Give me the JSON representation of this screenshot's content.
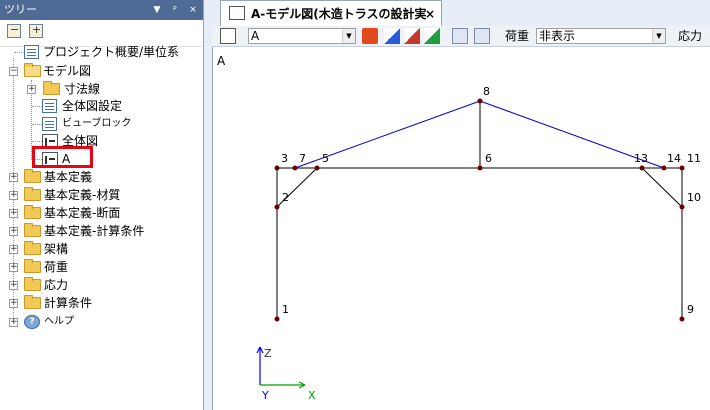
{
  "tree": {
    "title": "ツリー",
    "header_buttons": [
      "▼",
      "ᵖ",
      "×"
    ],
    "items": [
      {
        "label": "プロジェクト概要/単位系",
        "icon": "doc-icon"
      },
      {
        "label": "モデル図",
        "icon": "folder-open-icon"
      },
      {
        "label": "寸法線",
        "icon": "folder-icon"
      },
      {
        "label": "全体図設定",
        "icon": "doc-icon"
      },
      {
        "label": "ビューブロック",
        "icon": "doc-icon"
      },
      {
        "label": "全体図",
        "icon": "model-icon"
      },
      {
        "label": "A",
        "icon": "model-icon"
      },
      {
        "label": "基本定義",
        "icon": "folder-icon"
      },
      {
        "label": "基本定義-材質",
        "icon": "folder-icon"
      },
      {
        "label": "基本定義-断面",
        "icon": "folder-icon"
      },
      {
        "label": "基本定義-計算条件",
        "icon": "folder-icon"
      },
      {
        "label": "架構",
        "icon": "folder-icon"
      },
      {
        "label": "荷重",
        "icon": "folder-icon"
      },
      {
        "label": "応力",
        "icon": "folder-icon"
      },
      {
        "label": "計算条件",
        "icon": "folder-icon"
      },
      {
        "label": "ヘルプ",
        "icon": "help-icon"
      }
    ]
  },
  "document_tab": {
    "title": "A-モデル図(木造トラスの設計実習)",
    "close": "×"
  },
  "toolbar": {
    "view_select": "A",
    "load_label": "荷重",
    "load_select": "非表示",
    "stress_label": "応力"
  },
  "canvas": {
    "view_name": "A",
    "nodes": [
      {
        "id": "1"
      },
      {
        "id": "2"
      },
      {
        "id": "3"
      },
      {
        "id": "5"
      },
      {
        "id": "6"
      },
      {
        "id": "7"
      },
      {
        "id": "8"
      },
      {
        "id": "9"
      },
      {
        "id": "10"
      },
      {
        "id": "11"
      },
      {
        "id": "13"
      },
      {
        "id": "14"
      }
    ],
    "axes": {
      "z": "Z",
      "y": "Y",
      "x": "X"
    },
    "colors": {
      "member_black": "#000000",
      "member_blue": "#0000c8",
      "node": "#6b0000",
      "axis_z": "#0000ff",
      "axis_x": "#00a000"
    }
  }
}
